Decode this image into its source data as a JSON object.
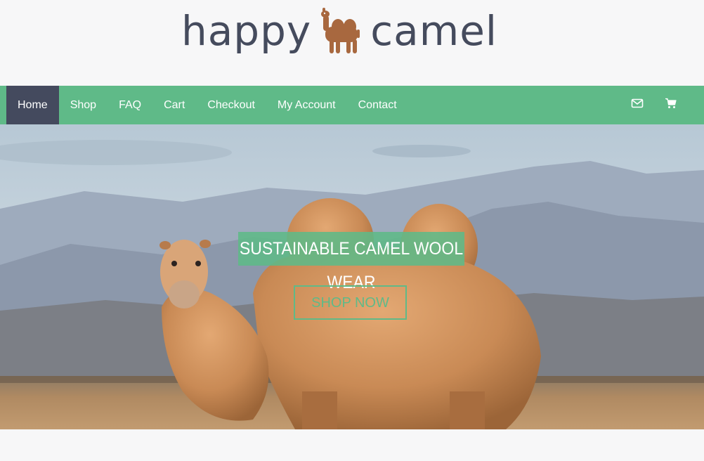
{
  "brand": {
    "word_left": "happy",
    "word_right": "camel",
    "logo_icon": "camel-icon",
    "text_color": "#454b5d",
    "icon_color": "#a8683f"
  },
  "nav": {
    "items": [
      {
        "label": "Home",
        "active": true
      },
      {
        "label": "Shop"
      },
      {
        "label": "FAQ"
      },
      {
        "label": "Cart"
      },
      {
        "label": "Checkout"
      },
      {
        "label": "My Account"
      },
      {
        "label": "Contact"
      }
    ],
    "icons": [
      "envelope-icon",
      "cart-icon"
    ],
    "bar_color": "#5fba88",
    "active_color": "#444a5e"
  },
  "hero": {
    "image": "camel-in-mountain-desert",
    "headline": "SUSTAINABLE CAMEL WOOL WEAR",
    "cta_label": "SHOP NOW",
    "accent": "#5fba88"
  }
}
